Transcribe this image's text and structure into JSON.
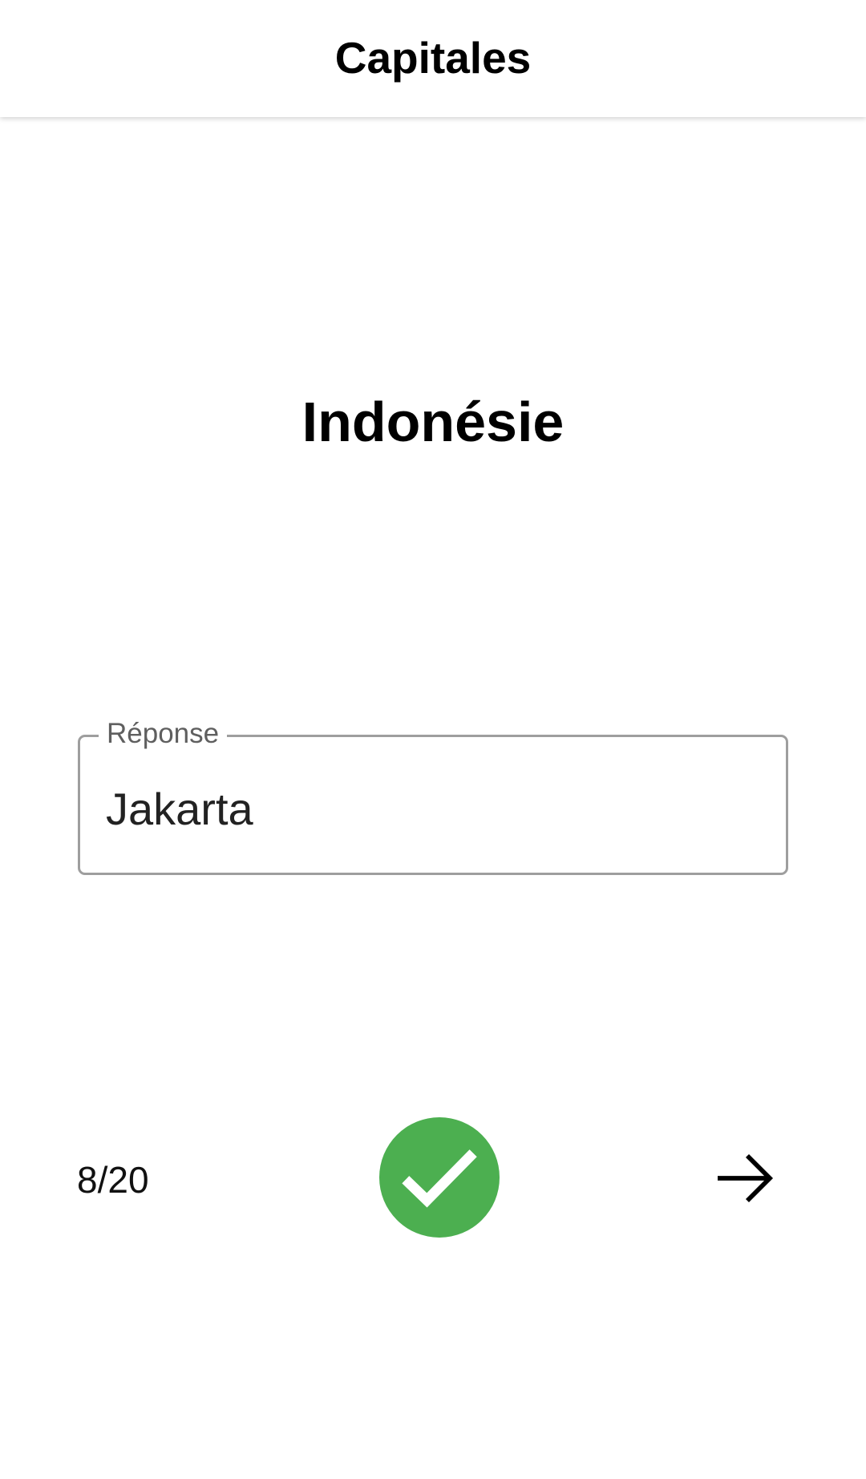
{
  "app_bar": {
    "title": "Capitales"
  },
  "question": {
    "country": "Indonésie"
  },
  "answer": {
    "label": "Réponse",
    "value": "Jakarta"
  },
  "footer": {
    "progress": "8/20",
    "result_icon": "check-icon",
    "result_color": "#4caf50",
    "next_icon": "arrow-right-icon"
  }
}
